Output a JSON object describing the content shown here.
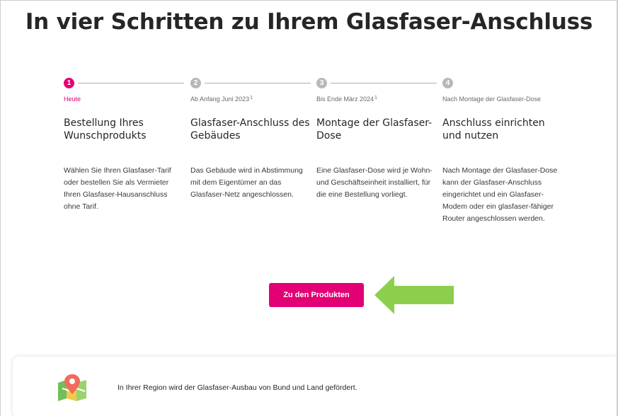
{
  "headline": "In vier Schritten zu Ihrem Glasfaser-Anschluss",
  "steps": [
    {
      "number": "1",
      "when": "Heute",
      "footnote": "",
      "title": "Bestellung Ihres Wunschprodukts",
      "text": "Wählen Sie Ihren Glasfaser-Tarif oder bestellen Sie als Vermieter Ihren Glasfaser-Hausanschluss ohne Tarif."
    },
    {
      "number": "2",
      "when": "Ab Anfang Juni 2023",
      "footnote": "1",
      "title": "Glasfaser-Anschluss des Gebäudes",
      "text": "Das Gebäude wird in Abstimmung mit dem Eigentümer an das Glasfaser-Netz angeschlossen."
    },
    {
      "number": "3",
      "when": "Bis Ende März 2024",
      "footnote": "1",
      "title": "Montage der Glasfaser-Dose",
      "text": "Eine Glasfaser-Dose wird je Wohn- und Geschäftseinheit installiert, für die eine Bestellung vorliegt."
    },
    {
      "number": "4",
      "when": "Nach Montage der Glasfaser-Dose",
      "footnote": "",
      "title": "Anschluss einrichten und nutzen",
      "text": "Nach Montage der Glasfaser-Dose kann der Glasfaser-Anschluss eingerichtet und ein Glasfaser-Modem oder ein glasfaser-fähiger Router angeschlossen werden."
    }
  ],
  "cta": {
    "label": "Zu den Produkten"
  },
  "info": {
    "text": "In Ihrer Region wird der Glasfaser-Ausbau von Bund und Land gefördert."
  },
  "icons": {
    "arrow": "arrow-left-icon",
    "map": "map-pin-icon"
  },
  "colors": {
    "brand": "#e20074",
    "arrow": "#8ccf4d",
    "inactive": "#b8b8b8"
  }
}
